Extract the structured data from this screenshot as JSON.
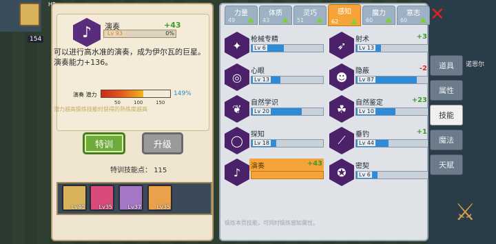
{
  "hud": {
    "hp_label": "HP",
    "badge": "154",
    "npc_name": "诺恩尔"
  },
  "detail": {
    "name": "演奏",
    "bonus": "+43",
    "level": "Lv 93",
    "level_pct": "0%",
    "description": "可以进行高水准的演奏，成为伊尔瓦的巨星。演奏能力+136。",
    "potential_label": "演奏 潜力",
    "potential_pct": "149%",
    "potential_value": 149,
    "potential_ticks": [
      "50",
      "100",
      "150"
    ],
    "note": "潜力越高锻炼技能时获得的熟练度越高",
    "train_label": "特训",
    "upgrade_label": "升级",
    "train_points_label": "特训技能点：",
    "train_points": "115",
    "icon": "music-note-icon"
  },
  "party": [
    {
      "level": "Lv40",
      "color": "#d9b35c"
    },
    {
      "level": "Lv35",
      "color": "#d94a7a"
    },
    {
      "level": "Lv37",
      "color": "#a478c6"
    },
    {
      "level": "Lv35",
      "color": "#e9a24a"
    }
  ],
  "tabs": [
    {
      "label": "力量",
      "value": "49"
    },
    {
      "label": "体质",
      "value": "43"
    },
    {
      "label": "灵巧",
      "value": "51"
    },
    {
      "label": "感知",
      "value": "62",
      "active": true
    },
    {
      "label": "魔力",
      "value": "60"
    },
    {
      "label": "意志",
      "value": "60"
    }
  ],
  "skills": [
    {
      "name": "枪械专精",
      "bonus": "",
      "level": "Lv 6",
      "fill": 0.45,
      "icon": "gun-icon"
    },
    {
      "name": "射术",
      "bonus": "+3",
      "level": "Lv 13",
      "fill": 0.35,
      "icon": "arrows-icon"
    },
    {
      "name": "心眼",
      "bonus": "",
      "level": "Lv 13",
      "fill": 0.4,
      "icon": "spiral-icon"
    },
    {
      "name": "隐蔽",
      "bonus": "-2",
      "level": "Lv 87",
      "fill": 0.85,
      "icon": "ghost-icon"
    },
    {
      "name": "自然学识",
      "bonus": "",
      "level": "Lv 20",
      "fill": 0.7,
      "icon": "leaf-icon"
    },
    {
      "name": "自然鉴定",
      "bonus": "+23",
      "level": "Lv 10",
      "fill": 0.55,
      "icon": "triquetra-icon"
    },
    {
      "name": "探知",
      "bonus": "",
      "level": "Lv 18",
      "fill": 0.35,
      "icon": "magnify-icon"
    },
    {
      "name": "垂钓",
      "bonus": "+1",
      "level": "Lv 44",
      "fill": 0.45,
      "icon": "fishing-rod-icon"
    },
    {
      "name": "演奏",
      "bonus": "+43",
      "level": "",
      "fill": 0.0,
      "icon": "music-note-icon",
      "highlight": true
    },
    {
      "name": "密契",
      "bonus": "",
      "level": "Lv 6",
      "fill": 0.3,
      "icon": "pentagram-icon"
    }
  ],
  "footer_note": "锻炼本页技能，可同时锻炼感知属性。",
  "side_tabs": [
    {
      "label": "道具"
    },
    {
      "label": "属性"
    },
    {
      "label": "技能",
      "active": true
    },
    {
      "label": "魔法"
    },
    {
      "label": "天赋"
    }
  ]
}
